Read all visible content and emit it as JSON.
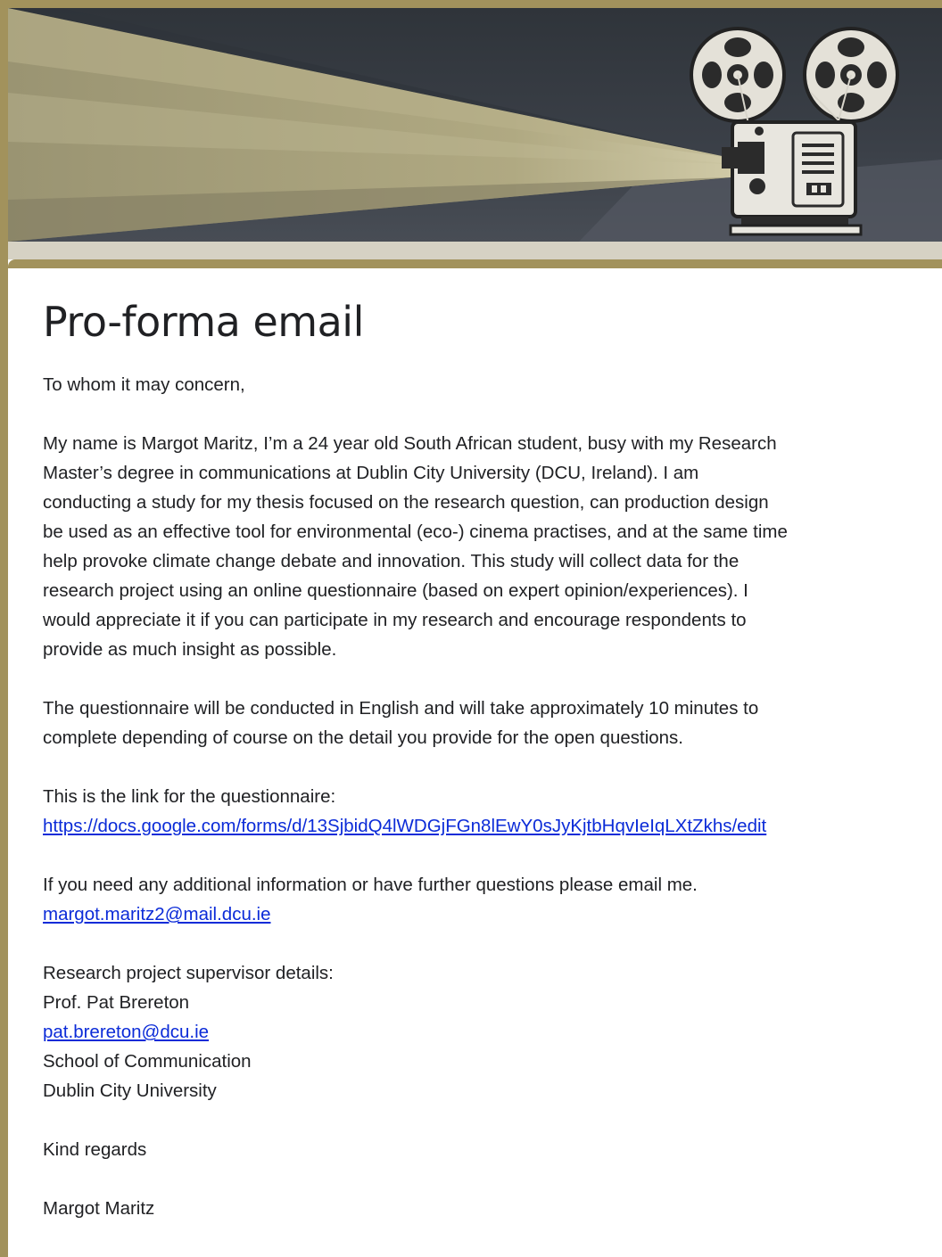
{
  "colors": {
    "accent": "#a2925c",
    "banner_dark": "#3a3f46",
    "light_beam": "#a7a07c",
    "link": "#0b2bd8",
    "band": "#d6d2c4"
  },
  "header": {
    "banner_icon": "film-projector-icon"
  },
  "form": {
    "title": "Pro-forma email",
    "greeting": "To whom it may concern,",
    "intro": [
      "My name is Margot Maritz, I’m a 24 year old South African student, busy with my Research",
      "Master’s degree in communications at Dublin City University (DCU, Ireland).  I am",
      "conducting a study for my thesis focused on the research question, can production design",
      "be used as an effective tool for environmental (eco-) cinema practises, and at the same time",
      "help provoke climate change debate and innovation. This study will collect data for the",
      "research project using an online questionnaire (based on expert opinion/experiences). I",
      "would appreciate it if you can participate in my research and encourage respondents to",
      "provide as much insight as possible."
    ],
    "duration": [
      "The questionnaire will be conducted in English and will take approximately 10 minutes to",
      "complete depending of course on the detail you provide for the open questions."
    ],
    "link_label": "This is the link for the questionnaire:",
    "link_url": "https://docs.google.com/forms/d/13SjbidQ4lWDGjFGn8lEwY0sJyKjtbHqvIeIqLXtZkhs/edit",
    "contact_text": "If you need any additional information or have further questions please email me.",
    "contact_email": "margot.maritz2@mail.dcu.ie",
    "supervisor_heading": "Research project supervisor details:",
    "supervisor_name": "Prof. Pat Brereton",
    "supervisor_email": "pat.brereton@dcu.ie",
    "supervisor_school": "School of Communication",
    "supervisor_university": "Dublin City University",
    "closing": "Kind regards",
    "signature": "Margot Maritz"
  }
}
